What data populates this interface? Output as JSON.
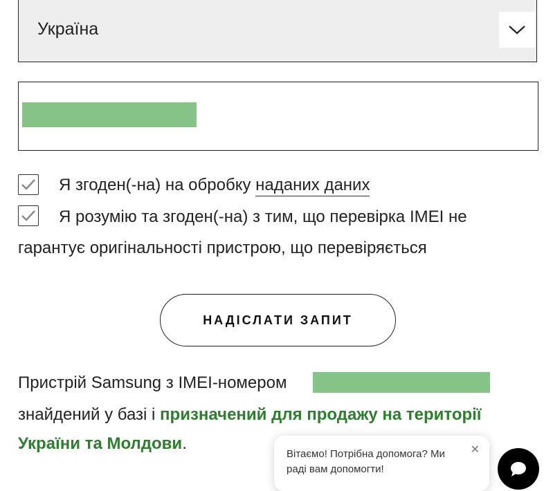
{
  "country_select": {
    "value": "Україна",
    "icon": "chevron-down-icon"
  },
  "imei_field": {
    "value": ""
  },
  "consents": [
    {
      "checked": true,
      "text_before": "Я згоден(-на) на обробку ",
      "link_text": "наданих даних"
    },
    {
      "checked": true,
      "line1": "Я розумію та згоден(-на) з тим, що перевірка IMEI не",
      "line2": "гарантує оригінальності пристрою, що перевіряється"
    }
  ],
  "submit_button": {
    "label": "НАДІСЛАТИ ЗАПИТ"
  },
  "result": {
    "line1_prefix": "Пристрій Samsung з IMEI-номером",
    "line2_prefix": "знайдений у базі і ",
    "line2_highlight": "призначений для продажу на території",
    "line3_highlight": "України та Молдови",
    "line3_suffix": ".",
    "highlight_color": "#2f7d2f"
  },
  "chat": {
    "greeting": "Вітаємо! Потрібна допомога? Ми раді вам допомогти!",
    "close_icon": "close-icon",
    "button_icon": "chat-icon"
  },
  "colors": {
    "redaction": "#86c387",
    "select_background": "#eeeeee"
  }
}
